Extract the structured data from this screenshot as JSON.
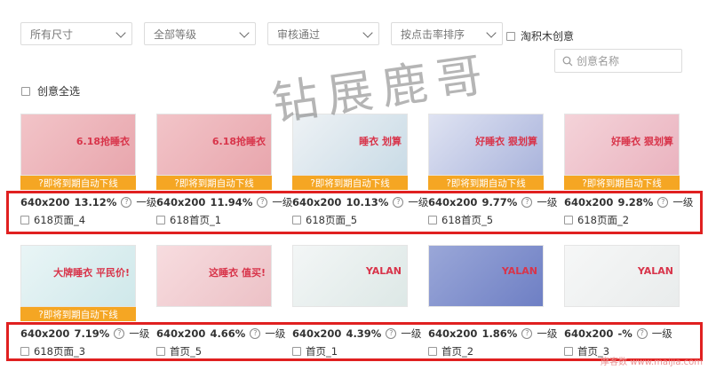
{
  "filters": {
    "size": "所有尺寸",
    "level": "全部等级",
    "status": "审核通过",
    "sort": "按点击率排序",
    "checkbox_label": "淘积木创意"
  },
  "search": {
    "placeholder": "创意名称"
  },
  "select_all_label": "创意全选",
  "watermark": "钻展鹿哥",
  "corner_mark": "摩客数 www.maijia.com",
  "row1": [
    {
      "size": "640x200",
      "rate": "13.12%",
      "level": "一级",
      "name": "618页面_4",
      "banner": "?即将到期自动下线",
      "thumb_text": "6.18抢睡衣"
    },
    {
      "size": "640x200",
      "rate": "11.94%",
      "level": "一级",
      "name": "618首页_1",
      "banner": "?即将到期自动下线",
      "thumb_text": "6.18抢睡衣"
    },
    {
      "size": "640x200",
      "rate": "10.13%",
      "level": "一级",
      "name": "618页面_5",
      "banner": "?即将到期自动下线",
      "thumb_text": "睡衣 划算"
    },
    {
      "size": "640x200",
      "rate": "9.77%",
      "level": "一级",
      "name": "618首页_5",
      "banner": "?即将到期自动下线",
      "thumb_text": "好睡衣 狠划算"
    },
    {
      "size": "640x200",
      "rate": "9.28%",
      "level": "一级",
      "name": "618页面_2",
      "banner": "?即将到期自动下线",
      "thumb_text": "好睡衣 狠划算"
    }
  ],
  "row2": [
    {
      "size": "640x200",
      "rate": "7.19%",
      "level": "一级",
      "name": "618页面_3",
      "banner": "?即将到期自动下线",
      "thumb_text": "大牌睡衣 平民价!"
    },
    {
      "size": "640x200",
      "rate": "4.66%",
      "level": "一级",
      "name": "首页_5",
      "banner": "",
      "thumb_text": "这睡衣 值买!"
    },
    {
      "size": "640x200",
      "rate": "4.39%",
      "level": "一级",
      "name": "首页_1",
      "banner": "",
      "thumb_text": "YALAN"
    },
    {
      "size": "640x200",
      "rate": "1.86%",
      "level": "一级",
      "name": "首页_2",
      "banner": "",
      "thumb_text": "YALAN"
    },
    {
      "size": "640x200",
      "rate": "-%",
      "level": "一级",
      "name": "首页_3",
      "banner": "",
      "thumb_text": "YALAN"
    }
  ]
}
